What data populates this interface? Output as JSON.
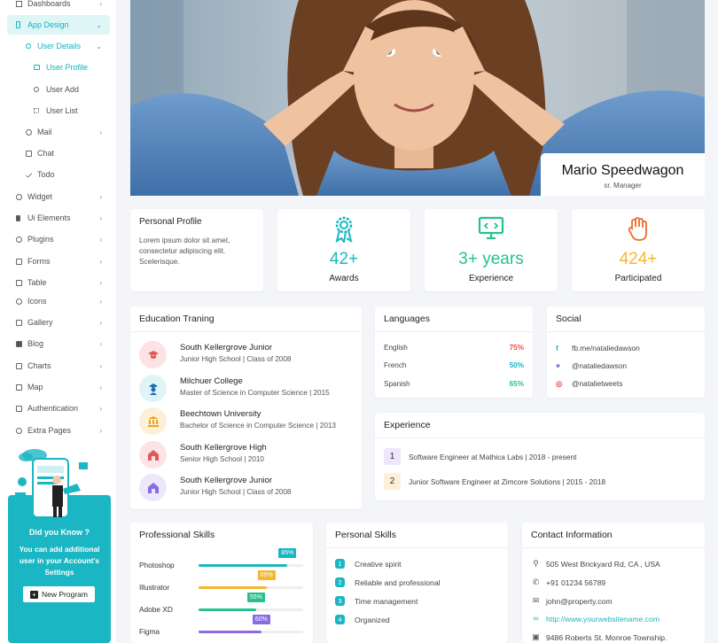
{
  "sidebar": {
    "items": [
      {
        "label": "Dashboards",
        "icon": "home-icon"
      },
      {
        "label": "App Design",
        "icon": "phone-icon"
      },
      {
        "label": "User Details",
        "icon": "user-group-icon"
      },
      {
        "label": "User Profile",
        "icon": "id-card-icon"
      },
      {
        "label": "User Add",
        "icon": "user-plus-icon"
      },
      {
        "label": "User List",
        "icon": "list-icon"
      },
      {
        "label": "Mail",
        "icon": "mail-icon"
      },
      {
        "label": "Chat",
        "icon": "chat-icon"
      },
      {
        "label": "Todo",
        "icon": "check-icon"
      },
      {
        "label": "Widget",
        "icon": "widget-icon"
      },
      {
        "label": "Ui Elements",
        "icon": "ui-icon"
      },
      {
        "label": "Plugins",
        "icon": "plugin-icon"
      },
      {
        "label": "Forms",
        "icon": "form-icon"
      },
      {
        "label": "Table",
        "icon": "table-icon"
      },
      {
        "label": "Icons",
        "icon": "icons-icon"
      },
      {
        "label": "Gallery",
        "icon": "gallery-icon"
      },
      {
        "label": "Blog",
        "icon": "blog-icon"
      },
      {
        "label": "Charts",
        "icon": "chart-icon"
      },
      {
        "label": "Map",
        "icon": "map-icon"
      },
      {
        "label": "Authentication",
        "icon": "lock-icon"
      },
      {
        "label": "Extra Pages",
        "icon": "pages-icon"
      }
    ],
    "promo": {
      "title": "Did you Know ?",
      "text": "You can add additional user in your Account's Settings",
      "button": "New Program"
    }
  },
  "profile": {
    "name": "Mario Speedwagon",
    "role": "sr. Manager"
  },
  "personal_profile": {
    "title": "Personal Profile",
    "text": "Lorem ipsum dolor sit amet, consectetur adipiscing elit. Scelerisque."
  },
  "stats": [
    {
      "value": "42+",
      "label": "Awards",
      "color": "#1ab6c3",
      "icon": "award-ribbon-icon"
    },
    {
      "value": "3+ years",
      "label": "Experience",
      "color": "#27c28a",
      "icon": "code-monitor-icon"
    },
    {
      "value": "424+",
      "label": "Participated",
      "color": "#f7b731",
      "icon": "raised-hand-icon"
    }
  ],
  "education": {
    "title": "Education Traning",
    "items": [
      {
        "title": "South Kellergrove Junior",
        "sub": "Junior High School | Class of 2008",
        "bg": "#fde3e3",
        "color": "#e05a5a"
      },
      {
        "title": "Milchuer College",
        "sub": "Master of Science in Computer Science | 2015",
        "bg": "#dff4f7",
        "color": "#1ab6c3"
      },
      {
        "title": "Beechtown University",
        "sub": "Bachelor of Science in Computer Science | 2013",
        "bg": "#fdf0d9",
        "color": "#f0a020"
      },
      {
        "title": "South Kellergrove High",
        "sub": "Senior High School | 2010",
        "bg": "#e0f5ec",
        "color": "#27c28a"
      },
      {
        "title": "South Kellergrove Junior",
        "sub": "Junior High School | Class of 2008",
        "bg": "#ece7fb",
        "color": "#8a6be0"
      }
    ]
  },
  "languages": {
    "title": "Languages",
    "items": [
      {
        "name": "English",
        "value": "75%",
        "color": "#ef4b4b"
      },
      {
        "name": "French",
        "value": "50%",
        "color": "#1ab6c3"
      },
      {
        "name": "Spanish",
        "value": "65%",
        "color": "#27c28a"
      }
    ]
  },
  "social": {
    "title": "Social",
    "items": [
      {
        "text": "fb.me/nataliedawson",
        "icon": "facebook-icon",
        "glyph": "f",
        "color": "#1ab6c3"
      },
      {
        "text": "@nataliedawson",
        "icon": "twitter-icon",
        "glyph": "🐦",
        "color": "#7b6be0"
      },
      {
        "text": "@natalietweets",
        "icon": "instagram-icon",
        "glyph": "◎",
        "color": "#ef4b4b"
      }
    ]
  },
  "experience": {
    "title": "Experience",
    "items": [
      {
        "num": "1",
        "text": "Software Engineer at Mathica Labs | 2018 - present",
        "bg": "#ece7fb"
      },
      {
        "num": "2",
        "text": "Junior Software Engineer at Zimcore Solutions | 2015 - 2018",
        "bg": "#fdf0d9"
      }
    ]
  },
  "skills": {
    "title": "Professional Skills",
    "items": [
      {
        "name": "Photoshop",
        "value": 85,
        "label": "85%",
        "color": "#1ab6c3"
      },
      {
        "name": "Illustrator",
        "value": 65,
        "label": "65%",
        "color": "#f7b731"
      },
      {
        "name": "Adobe XD",
        "value": 55,
        "label": "55%",
        "color": "#27c28a"
      },
      {
        "name": "Figma",
        "value": 60,
        "label": "60%",
        "color": "#8a6be0"
      }
    ]
  },
  "personal_skills": {
    "title": "Personal Skills",
    "items": [
      {
        "num": "1",
        "text": "Creative spirit"
      },
      {
        "num": "2",
        "text": "Reliable and professional"
      },
      {
        "num": "3",
        "text": "Time management"
      },
      {
        "num": "4",
        "text": "Organized"
      }
    ]
  },
  "contact": {
    "title": "Contact Information",
    "items": [
      {
        "text": "505 West Brickyard Rd, CA , USA",
        "icon": "location-pin-icon",
        "glyph": "⚲"
      },
      {
        "text": "+91 01234 56789",
        "icon": "phone-icon",
        "glyph": "✆"
      },
      {
        "text": "john@property.com",
        "icon": "mail-icon",
        "glyph": "✉"
      },
      {
        "text": "http://www.yourwebsitename.com",
        "icon": "link-icon",
        "glyph": "🔗",
        "link": true
      },
      {
        "text": "9486 Roberts St. Monroe Township.",
        "icon": "briefcase-icon",
        "glyph": "▣"
      }
    ]
  }
}
